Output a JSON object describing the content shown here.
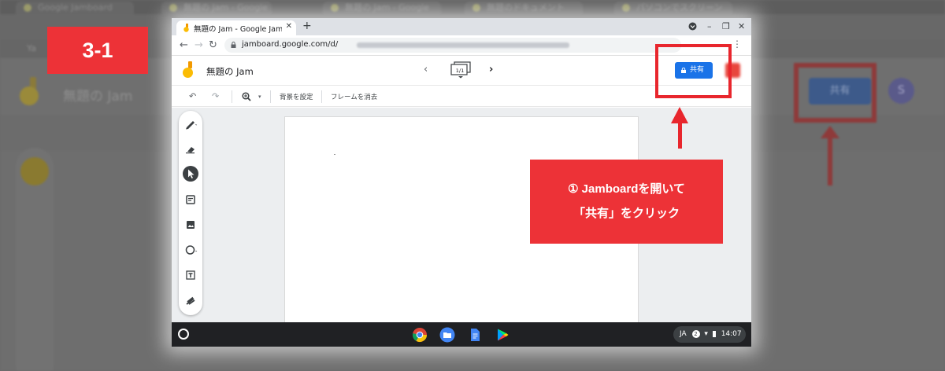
{
  "step_badge": "3-1",
  "background": {
    "title": "無題の Jam",
    "share_label": "共有",
    "avatar_initial": "S",
    "bookmark_prefix": "Ya",
    "tab_fragments": [
      "Google Jamboard",
      "無題の Jam - Google",
      "無題の Jam - Google",
      "無題のドキュメント",
      "パソコンでスクリーン"
    ]
  },
  "browser": {
    "tab_title": "無題の Jam - Google Jamboard",
    "url": "jamboard.google.com/d/",
    "win_minimize": "–",
    "win_restore": "❐",
    "win_close": "✕",
    "new_tab": "+",
    "tab_close": "✕"
  },
  "app": {
    "doc_title": "無題の Jam",
    "frame_counter": "1/1",
    "share_label": "共有"
  },
  "toolbar": {
    "set_background": "背景を設定",
    "clear_frame": "フレームを消去"
  },
  "callout": {
    "line1": "① Jamboardを開いて",
    "line2": "「共有」をクリック"
  },
  "taskbar": {
    "language": "JA",
    "notifications": "2",
    "time": "14:07"
  },
  "colors": {
    "accent_red": "#ed3237",
    "share_blue": "#1a73e8"
  }
}
